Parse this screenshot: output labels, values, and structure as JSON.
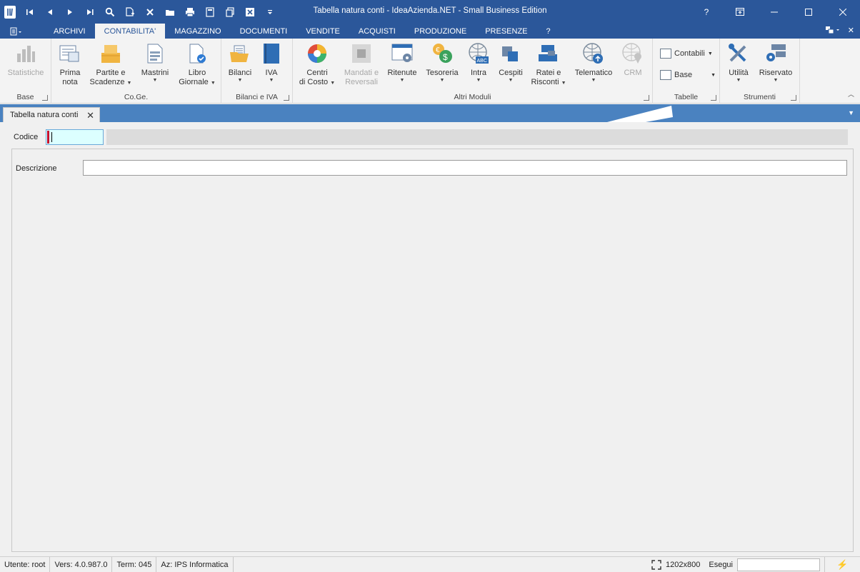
{
  "window": {
    "title": "Tabella natura conti - IdeaAzienda.NET - Small Business Edition",
    "help": "?"
  },
  "colors": {
    "accent": "#2b579a",
    "docbar": "#4a82c0",
    "required_marker": "#c8102e",
    "focus_field": "#dcffff"
  },
  "menu": {
    "tabs": [
      "ARCHIVI",
      "CONTABILITA'",
      "MAGAZZINO",
      "DOCUMENTI",
      "VENDITE",
      "ACQUISTI",
      "PRODUZIONE",
      "PRESENZE",
      "?"
    ],
    "active_tab": "CONTABILITA'"
  },
  "ribbon": {
    "groups": {
      "base": "Base",
      "coge": "Co.Ge.",
      "bilanci_iva": "Bilanci e IVA",
      "altri_moduli": "Altri Moduli",
      "tabelle": "Tabelle",
      "strumenti": "Strumenti"
    },
    "buttons": {
      "statistiche": "Statistiche",
      "prima_nota_1": "Prima",
      "prima_nota_2": "nota",
      "partite_1": "Partite e",
      "partite_2": "Scadenze",
      "mastrini": "Mastrini",
      "libro_1": "Libro",
      "libro_2": "Giornale",
      "bilanci": "Bilanci",
      "iva": "IVA",
      "centri_1": "Centri",
      "centri_2": "di Costo",
      "mandati_1": "Mandati e",
      "mandati_2": "Reversali",
      "ritenute": "Ritenute",
      "tesoreria": "Tesoreria",
      "intra": "Intra",
      "cespiti": "Cespiti",
      "ratei_1": "Ratei e",
      "ratei_2": "Risconti",
      "telematico": "Telematico",
      "crm": "CRM",
      "contabili": "Contabili",
      "base_tab": "Base",
      "utilita": "Utilità",
      "riservato": "Riservato"
    }
  },
  "document_tab": {
    "label": "Tabella natura conti"
  },
  "form": {
    "codice_label": "Codice",
    "codice_value": "",
    "descrizione_label": "Descrizione",
    "descrizione_value": ""
  },
  "statusbar": {
    "utente": "Utente: root",
    "versione": "Vers: 4.0.987.0",
    "term": "Term: 045",
    "azienda": "Az: IPS Informatica",
    "resolution": "1202x800",
    "esegui_label": "Esegui",
    "esegui_value": ""
  }
}
